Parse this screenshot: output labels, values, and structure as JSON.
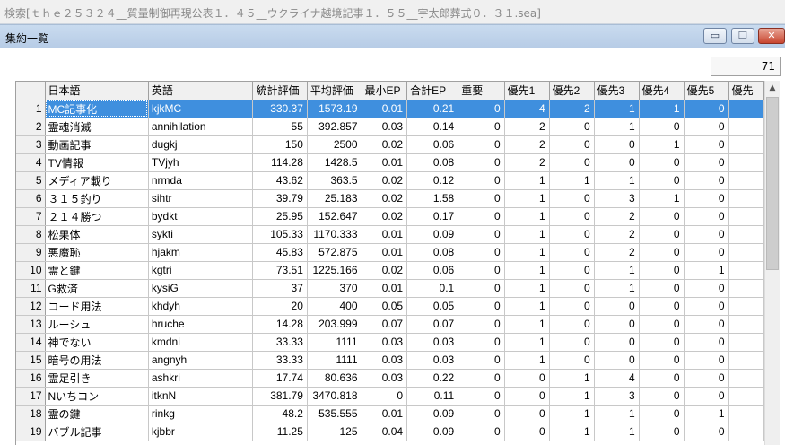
{
  "outer_window": {
    "title": "検索[ｔｈｅ２５３２４__質量制御再現公表１．４５__ウクライナ越境記事１．５５__宇太郎葬式０．３１.sea]"
  },
  "inner_window": {
    "title": "集約一覧",
    "minimize_glyph": "▭",
    "restore_glyph": "❐",
    "close_glyph": "✕"
  },
  "count": "71",
  "table": {
    "columns": [
      "",
      "日本語",
      "英語",
      "統計評価",
      "平均評価",
      "最小EP",
      "合計EP",
      "重要",
      "優先1",
      "優先2",
      "優先3",
      "優先4",
      "優先5",
      "優先"
    ],
    "rows": [
      [
        "1",
        "MC記事化",
        "kjkMC",
        "330.37",
        "1573.19",
        "0.01",
        "0.21",
        "0",
        "4",
        "2",
        "1",
        "1",
        "0"
      ],
      [
        "2",
        "霊魂消滅",
        "annihilation",
        "55",
        "392.857",
        "0.03",
        "0.14",
        "0",
        "2",
        "0",
        "1",
        "0",
        "0"
      ],
      [
        "3",
        "動画記事",
        "dugkj",
        "150",
        "2500",
        "0.02",
        "0.06",
        "0",
        "2",
        "0",
        "0",
        "1",
        "0"
      ],
      [
        "4",
        "TV情報",
        "TVjyh",
        "114.28",
        "1428.5",
        "0.01",
        "0.08",
        "0",
        "2",
        "0",
        "0",
        "0",
        "0"
      ],
      [
        "5",
        "メディア載り",
        "nrmda",
        "43.62",
        "363.5",
        "0.02",
        "0.12",
        "0",
        "1",
        "1",
        "1",
        "0",
        "0"
      ],
      [
        "6",
        "３１５釣り",
        "sihtr",
        "39.79",
        "25.183",
        "0.02",
        "1.58",
        "0",
        "1",
        "0",
        "3",
        "1",
        "0"
      ],
      [
        "7",
        "２１４勝つ",
        "bydkt",
        "25.95",
        "152.647",
        "0.02",
        "0.17",
        "0",
        "1",
        "0",
        "2",
        "0",
        "0"
      ],
      [
        "8",
        "松果体",
        "sykti",
        "105.33",
        "1170.333",
        "0.01",
        "0.09",
        "0",
        "1",
        "0",
        "2",
        "0",
        "0"
      ],
      [
        "9",
        "悪魔恥",
        "hjakm",
        "45.83",
        "572.875",
        "0.01",
        "0.08",
        "0",
        "1",
        "0",
        "2",
        "0",
        "0"
      ],
      [
        "10",
        "霊と鍵",
        "kgtri",
        "73.51",
        "1225.166",
        "0.02",
        "0.06",
        "0",
        "1",
        "0",
        "1",
        "0",
        "1"
      ],
      [
        "11",
        "G救済",
        "kysiG",
        "37",
        "370",
        "0.01",
        "0.1",
        "0",
        "1",
        "0",
        "1",
        "0",
        "0"
      ],
      [
        "12",
        "コード用法",
        "khdyh",
        "20",
        "400",
        "0.05",
        "0.05",
        "0",
        "1",
        "0",
        "0",
        "0",
        "0"
      ],
      [
        "13",
        "ルーシュ",
        "hruche",
        "14.28",
        "203.999",
        "0.07",
        "0.07",
        "0",
        "1",
        "0",
        "0",
        "0",
        "0"
      ],
      [
        "14",
        "神でない",
        "kmdni",
        "33.33",
        "1111",
        "0.03",
        "0.03",
        "0",
        "1",
        "0",
        "0",
        "0",
        "0"
      ],
      [
        "15",
        "暗号の用法",
        "angnyh",
        "33.33",
        "1111",
        "0.03",
        "0.03",
        "0",
        "1",
        "0",
        "0",
        "0",
        "0"
      ],
      [
        "16",
        "霊足引き",
        "ashkri",
        "17.74",
        "80.636",
        "0.03",
        "0.22",
        "0",
        "0",
        "1",
        "4",
        "0",
        "0"
      ],
      [
        "17",
        "Nいちコン",
        "itknN",
        "381.79",
        "3470.818",
        "0",
        "0.11",
        "0",
        "0",
        "1",
        "3",
        "0",
        "0"
      ],
      [
        "18",
        "霊の鍵",
        "rinkg",
        "48.2",
        "535.555",
        "0.01",
        "0.09",
        "0",
        "0",
        "1",
        "1",
        "0",
        "1"
      ],
      [
        "19",
        "バブル記事",
        "kjbbr",
        "11.25",
        "125",
        "0.04",
        "0.09",
        "0",
        "0",
        "1",
        "1",
        "0",
        "0"
      ]
    ]
  },
  "scrollbar": {
    "up_glyph": "▲"
  }
}
